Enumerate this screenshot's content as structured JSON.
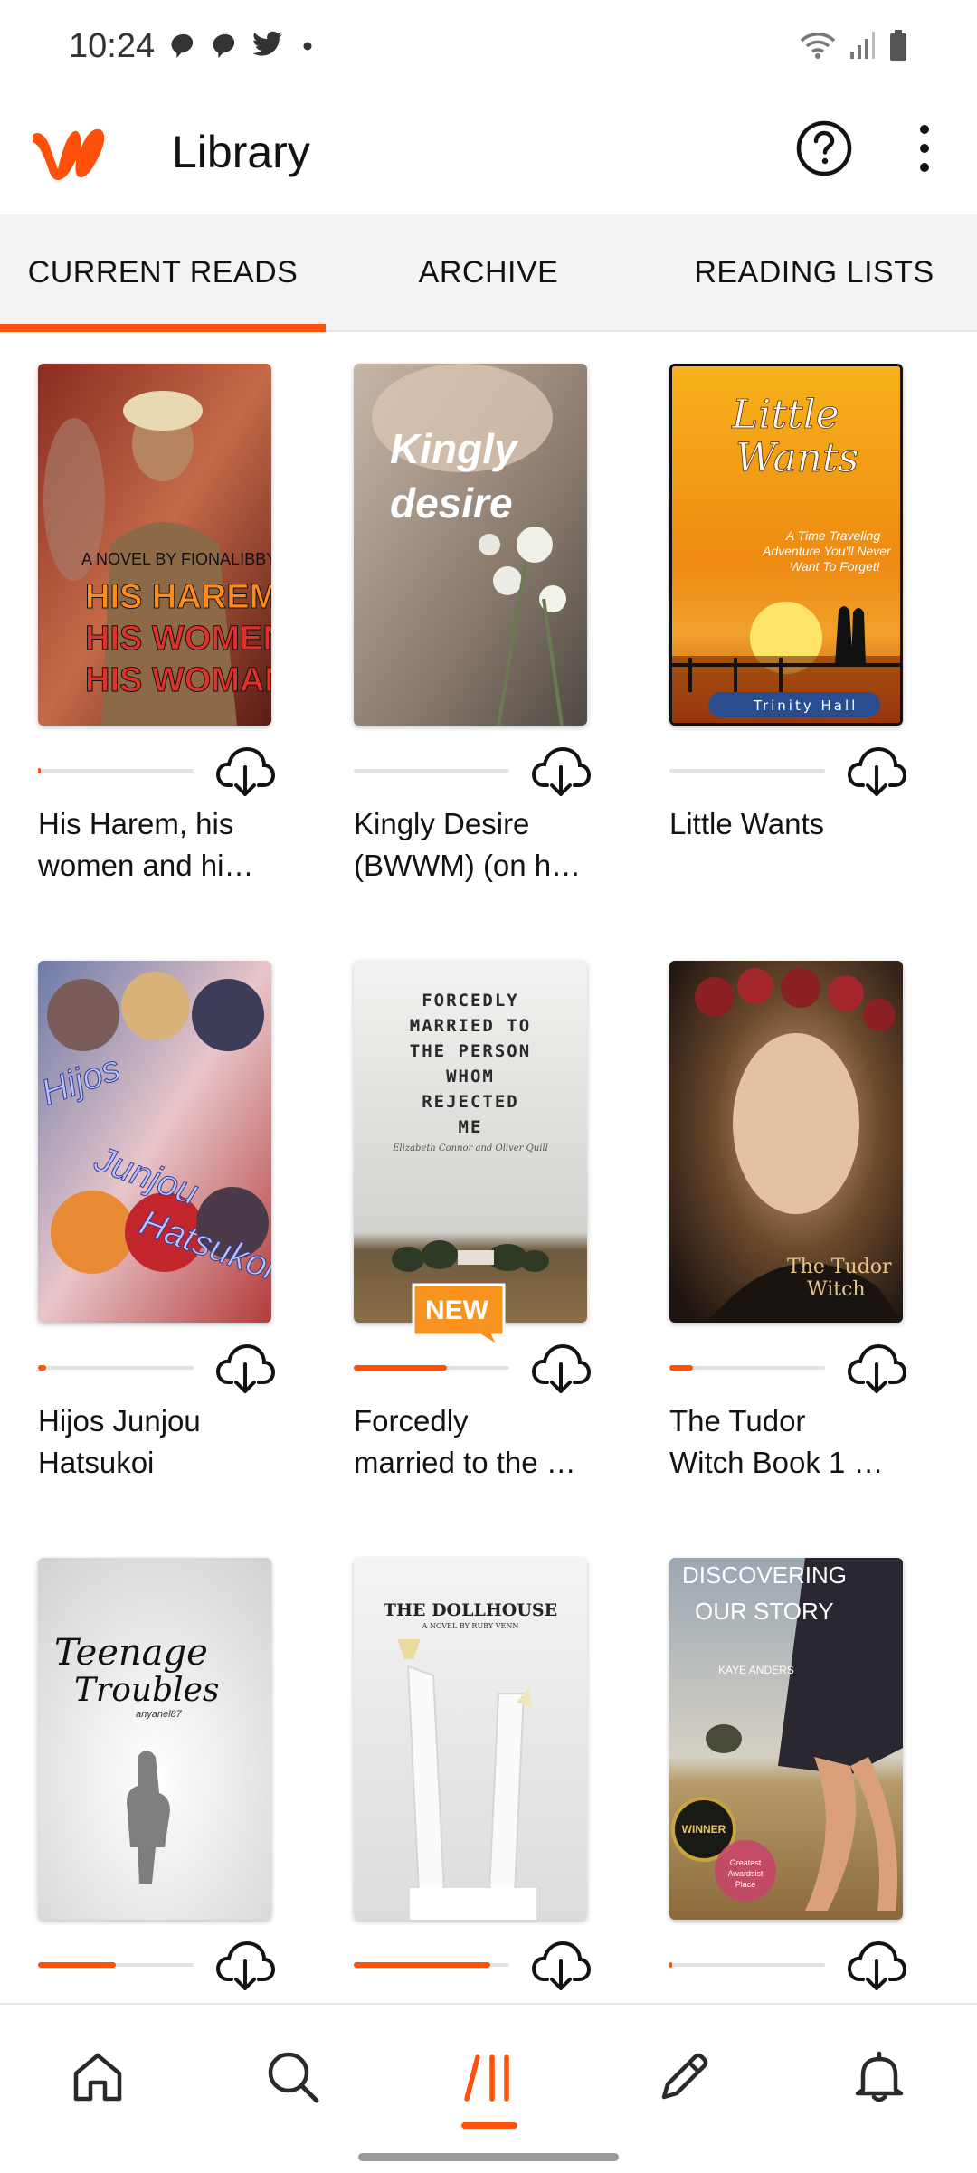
{
  "status_bar": {
    "time": "10:24",
    "notification_icons": [
      "chat-bubble-icon",
      "chat-bubble-icon",
      "twitter-bird-icon",
      "dot-icon"
    ],
    "system_icons": [
      "wifi-icon",
      "signal-icon",
      "battery-icon"
    ]
  },
  "header": {
    "title": "Library",
    "logo": "wattpad-logo",
    "actions": [
      "help-icon",
      "more-vertical-icon"
    ]
  },
  "tabs": [
    {
      "label": "CURRENT READS",
      "active": true
    },
    {
      "label": "ARCHIVE",
      "active": false
    },
    {
      "label": "READING LISTS",
      "active": false
    }
  ],
  "books": [
    {
      "title": "His Harem, his",
      "title_line2": "women and hi…",
      "progress": 0.01,
      "cover_text": [
        "A NOVEL BY FIONALIBBY",
        "HIS HAREM,",
        "HIS WOMEN",
        "HIS WOMAN."
      ]
    },
    {
      "title": "Kingly Desire",
      "title_line2": "(BWWM) (on h…",
      "progress": 0.0,
      "cover_text": [
        "Kingly",
        "desire"
      ]
    },
    {
      "title": "Little Wants",
      "title_line2": "",
      "progress": 0.0,
      "cover_text": [
        "Little",
        "Wants",
        "A Time Traveling",
        "Adventure You'll Never",
        "Want To Forget!",
        "Trinity Hall"
      ]
    },
    {
      "title": "Hijos Junjou",
      "title_line2": "Hatsukoi",
      "progress": 0.05,
      "cover_text": [
        "Hijos",
        "Junjou",
        "Hatsukoi"
      ]
    },
    {
      "title": "Forcedly",
      "title_line2": "married to the …",
      "progress": 0.6,
      "badge": "NEW",
      "cover_text": [
        "FORCEDLY",
        "MARRIED TO",
        "THE PERSON",
        "WHOM",
        "REJECTED",
        "ME",
        "Elizabeth Connor and Oliver Quill"
      ]
    },
    {
      "title": "The Tudor",
      "title_line2": "Witch Book 1 …",
      "progress": 0.15,
      "cover_text": [
        "The Tudor",
        "Witch"
      ]
    },
    {
      "title": "",
      "title_line2": "",
      "progress": 0.5,
      "cover_text": [
        "Teenage",
        "Troubles",
        "anyanel87"
      ]
    },
    {
      "title": "",
      "title_line2": "",
      "progress": 0.88,
      "cover_text": [
        "THE DOLLHOUSE",
        "A NOVEL BY RUBY VENN"
      ]
    },
    {
      "title": "",
      "title_line2": "",
      "progress": 0.02,
      "cover_text": [
        "DISCOVERING",
        "OUR STORY",
        "KAYE ANDERS",
        "WINNER",
        "Greatest",
        "Awardsist",
        "Place"
      ]
    }
  ],
  "bottom_nav": [
    {
      "icon": "home-icon",
      "active": false
    },
    {
      "icon": "search-icon",
      "active": false
    },
    {
      "icon": "library-icon",
      "active": true
    },
    {
      "icon": "pencil-icon",
      "active": false
    },
    {
      "icon": "bell-icon",
      "active": false
    }
  ],
  "colors": {
    "accent": "#ff500a",
    "tab_background": "#f3f3f3",
    "text": "#121212"
  }
}
